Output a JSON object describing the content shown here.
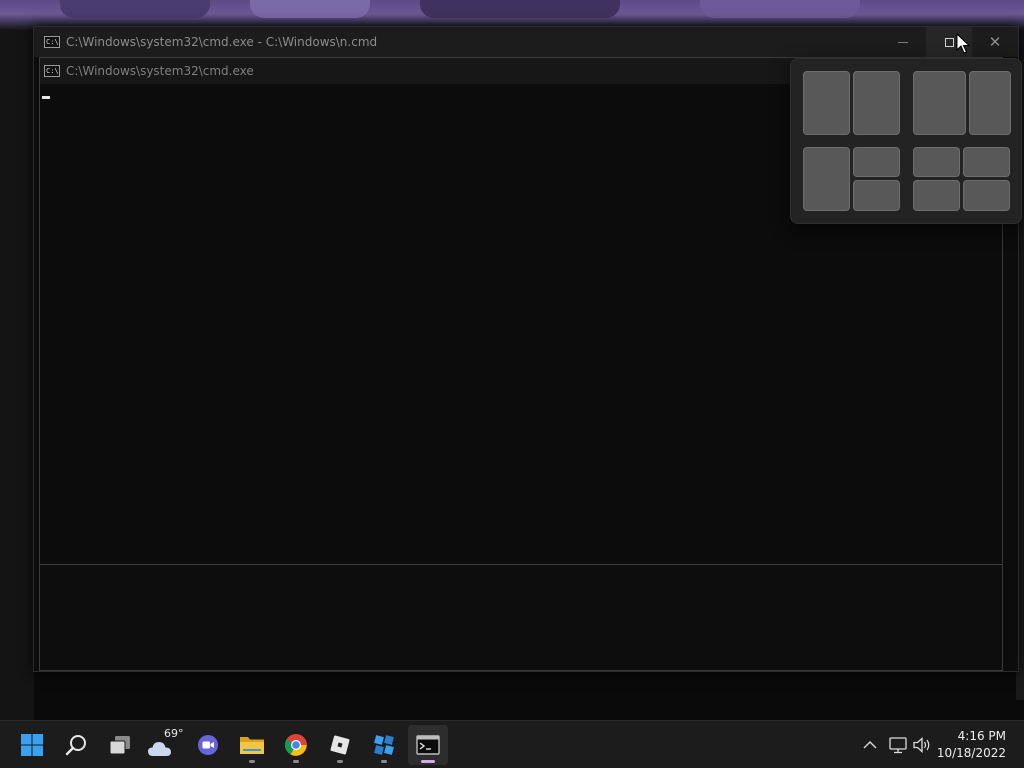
{
  "outer_window": {
    "title": "C:\\Windows\\system32\\cmd.exe - C:\\Windows\\n.cmd",
    "icon_text": "C:\\",
    "close_glyph": "✕"
  },
  "inner_window": {
    "title": "C:\\Windows\\system32\\cmd.exe",
    "icon_text": "C:\\"
  },
  "snap_layouts": {
    "options": [
      "two-columns-equal",
      "two-columns-wide-left",
      "main-with-two-stacked",
      "four-quadrants"
    ]
  },
  "taskbar": {
    "apps": [
      {
        "name": "start",
        "icon": "windows-logo-icon"
      },
      {
        "name": "search",
        "icon": "search-icon"
      },
      {
        "name": "task-view",
        "icon": "task-view-icon"
      },
      {
        "name": "weather",
        "icon": "weather-cloud-icon"
      },
      {
        "name": "teams-chat",
        "icon": "video-camera-icon"
      },
      {
        "name": "file-explorer",
        "icon": "folder-icon",
        "running": true
      },
      {
        "name": "chrome",
        "icon": "chrome-icon",
        "running": true
      },
      {
        "name": "roblox",
        "icon": "roblox-icon",
        "running": true
      },
      {
        "name": "roblox-studio",
        "icon": "roblox-studio-icon",
        "running": true
      },
      {
        "name": "command-prompt",
        "icon": "terminal-icon",
        "running": true,
        "active": true
      }
    ],
    "weather_temp": "69°",
    "tray": [
      "chevron-up-icon",
      "network-icon",
      "volume-icon"
    ],
    "clock_time": "4:16 PM",
    "clock_date": "10/18/2022"
  },
  "colors": {
    "accent_start": "#3aa0f0",
    "active_indicator": "#d6a9e8",
    "folder": "#f4c542"
  }
}
